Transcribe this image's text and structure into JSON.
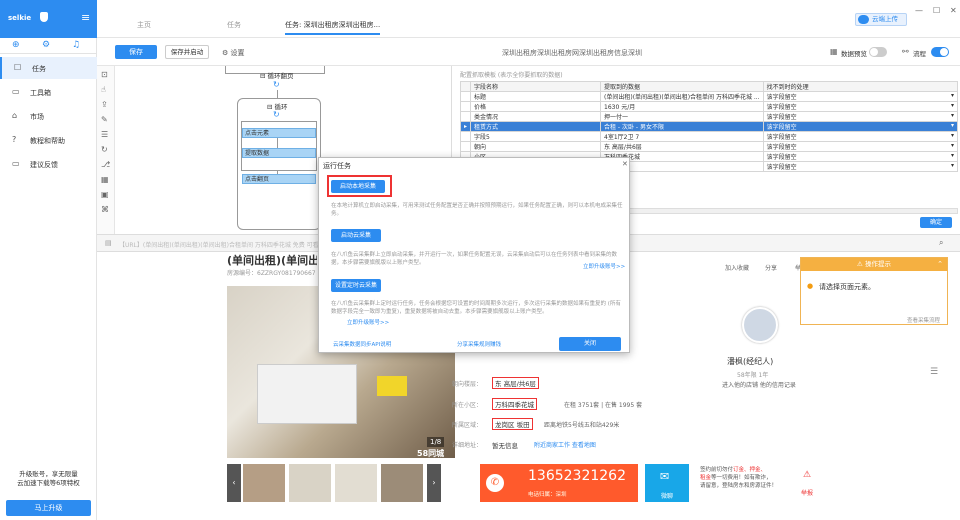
{
  "sidebar": {
    "user": "selkie",
    "items": [
      {
        "icon": "task-icon",
        "glyph": "☐",
        "label": "任务"
      },
      {
        "icon": "toolbox-icon",
        "glyph": "▭",
        "label": "工具箱"
      },
      {
        "icon": "market-icon",
        "glyph": "⌂",
        "label": "市场"
      },
      {
        "icon": "help-icon",
        "glyph": "?",
        "label": "教程和帮助"
      },
      {
        "icon": "feedback-icon",
        "glyph": "▭",
        "label": "建议反馈"
      }
    ],
    "upgrade_line1": "升级账号，享无限量",
    "upgrade_line2": "云加速下载等6项特权",
    "upgrade_button": "马上升级"
  },
  "tabs": [
    {
      "label": "主页"
    },
    {
      "label": "任务"
    },
    {
      "label": "任务: 深圳出租房深圳出租房..."
    }
  ],
  "cloud_upload": "云端上传",
  "toolbar": {
    "save": "保存",
    "save_start": "保存并启动",
    "settings": "设置",
    "task_title": "深圳出租房深圳出租房网深圳出租房信息深圳",
    "data_preview": "数据预览",
    "flow": "流程"
  },
  "workflow": {
    "loop_page": "循环翻页",
    "loop": "循环",
    "click_element": "点击元素",
    "extract_data": "提取数据",
    "click_page": "点击翻页"
  },
  "dtable": {
    "hint": "配置抓取模板 (表示全你要抓取的数据)",
    "headers": [
      "字段名称",
      "提取到的数据",
      "找不到时的处理"
    ],
    "rows": [
      [
        "标题",
        "(单间出租)(单间出租)(单间出租)合租单间 万科四季花城 ...",
        "该字段留空"
      ],
      [
        "价格",
        "1630 元/月",
        "该字段留空"
      ],
      [
        "类金情况",
        "押一付一",
        "该字段留空"
      ],
      [
        "租赁方式",
        "合租 - 次卧 - 男女不限",
        "该字段留空"
      ],
      [
        "字段5",
        "4室1厅2卫          7",
        "该字段留空"
      ],
      [
        "朝向",
        "东  高层/共6层",
        "该字段留空"
      ],
      [
        "小区",
        "万科四季花城",
        "该字段留空"
      ],
      [
        "区域",
        "龙岗区",
        "该字段留空"
      ]
    ],
    "confirm": "确定"
  },
  "url": "【URL】(单间出租)(单间出租)(单间出租)合租单间 万科四季花城 免费 可看",
  "modal": {
    "title": "运行任务",
    "btn_local": "启动本地采集",
    "desc_local": "在本地计算机立即启动采集，可用来测试任务配置是否正确并按照预期运行，如果任务配置正确，则可以本机电成采集任务。",
    "btn_cloud": "启动云采集",
    "desc_cloud": "在八爪鱼云采集群上立即启动采集，并开运行一次，如果任务配置无误，云采集启动后可以在任务列表中看到采集的数据，本步骤需要旗舰版以上账户类型。",
    "upgrade_link": "立即升级账号>>",
    "btn_timer": "设置定时云采集",
    "desc_timer": "在八爪鱼云采集群上定时运行任务，任务会根据您可设置的时间周期多次运行，多次运行采集的数据如果有重复的 (所有数据字段完全一致即为重复)，重复数据将被自动去重。本步骤需要旗舰版以上账户类型。",
    "upgrade_link2": "立即升级账号>>",
    "api_link": "云采集数据同步API说明",
    "share_link": "分享采集规则赚钱",
    "close": "关闭"
  },
  "tip": {
    "title": "操作提示",
    "text": "请选择页面元素。",
    "more": "查看采集流程"
  },
  "web": {
    "title": "(单间出租)(单间出租",
    "house_no": "房源编号：6ZZRGY081790667",
    "image_count": "1/8",
    "watermark": "58同城",
    "fav": "加入收藏",
    "share": "分享",
    "report": "举报",
    "agent_name": "潘枫(经纪人)",
    "agent_meta": "58年限  1年",
    "agent_links": "进入他的店铺  他的信用记录",
    "rows": [
      {
        "label": "朝向楼层：",
        "value": "东  高层/共6层"
      },
      {
        "label": "所在小区：",
        "value": "万科四季花城",
        "extra": "在租 3751套 | 在售 1995 套"
      },
      {
        "label": "所属区域：",
        "value": "龙岗区  坂田",
        "extra": "距离地铁5号线五和站429米"
      },
      {
        "label": "详细地址：",
        "value": "暂无信息",
        "extra": "附近商家工作  查看地图"
      }
    ],
    "phone": "13652321262",
    "phone_sub": "电话归属：深圳",
    "wechat": "微聊",
    "warn1": "签约前切勿付",
    "warn_red": "订金、押金、",
    "warn2": "租金",
    "warn3": "等一切费用！如有欺诈，",
    "warn4": "请留意，登陆房东和房源证件！",
    "report2": "举报"
  }
}
